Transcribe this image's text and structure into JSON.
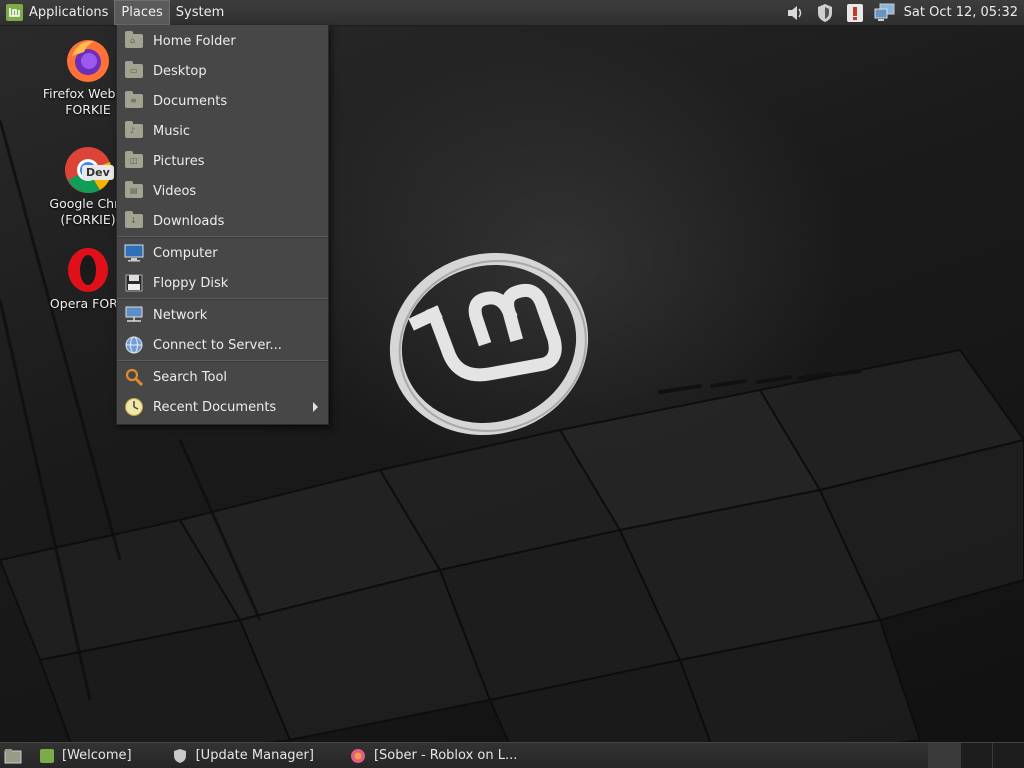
{
  "panel": {
    "menus": [
      "Applications",
      "Places",
      "System"
    ],
    "clock": "Sat Oct 12, 05:32"
  },
  "desktop_icons": [
    {
      "label_line1": "Firefox Web Br",
      "label_line2": "FORKIE",
      "icon": "firefox-icon"
    },
    {
      "label_line1": "Google Chro",
      "label_line2": "(FORKIE)",
      "icon": "chrome-dev-icon",
      "badge": "Dev"
    },
    {
      "label_line1": "Opera FORK",
      "label_line2": "",
      "icon": "opera-icon"
    }
  ],
  "places_menu": {
    "items": [
      {
        "label": "Home Folder"
      },
      {
        "label": "Desktop"
      },
      {
        "label": "Documents"
      },
      {
        "label": "Music"
      },
      {
        "label": "Pictures"
      },
      {
        "label": "Videos"
      },
      {
        "label": "Downloads"
      },
      {
        "label": "Computer"
      },
      {
        "label": "Floppy Disk"
      },
      {
        "label": "Network"
      },
      {
        "label": "Connect to Server..."
      },
      {
        "label": "Search Tool"
      },
      {
        "label": "Recent Documents"
      }
    ]
  },
  "taskbar": {
    "tasks": [
      {
        "label": "[Welcome]",
        "icon": "mint-welcome-icon"
      },
      {
        "label": "[Update Manager]",
        "icon": "shield-icon"
      },
      {
        "label": "[Sober - Roblox on L...",
        "icon": "sober-icon"
      }
    ]
  },
  "colors": {
    "accent_green": "#7cab4a",
    "panel_bg": "#333333",
    "menu_bg": "#474747"
  }
}
